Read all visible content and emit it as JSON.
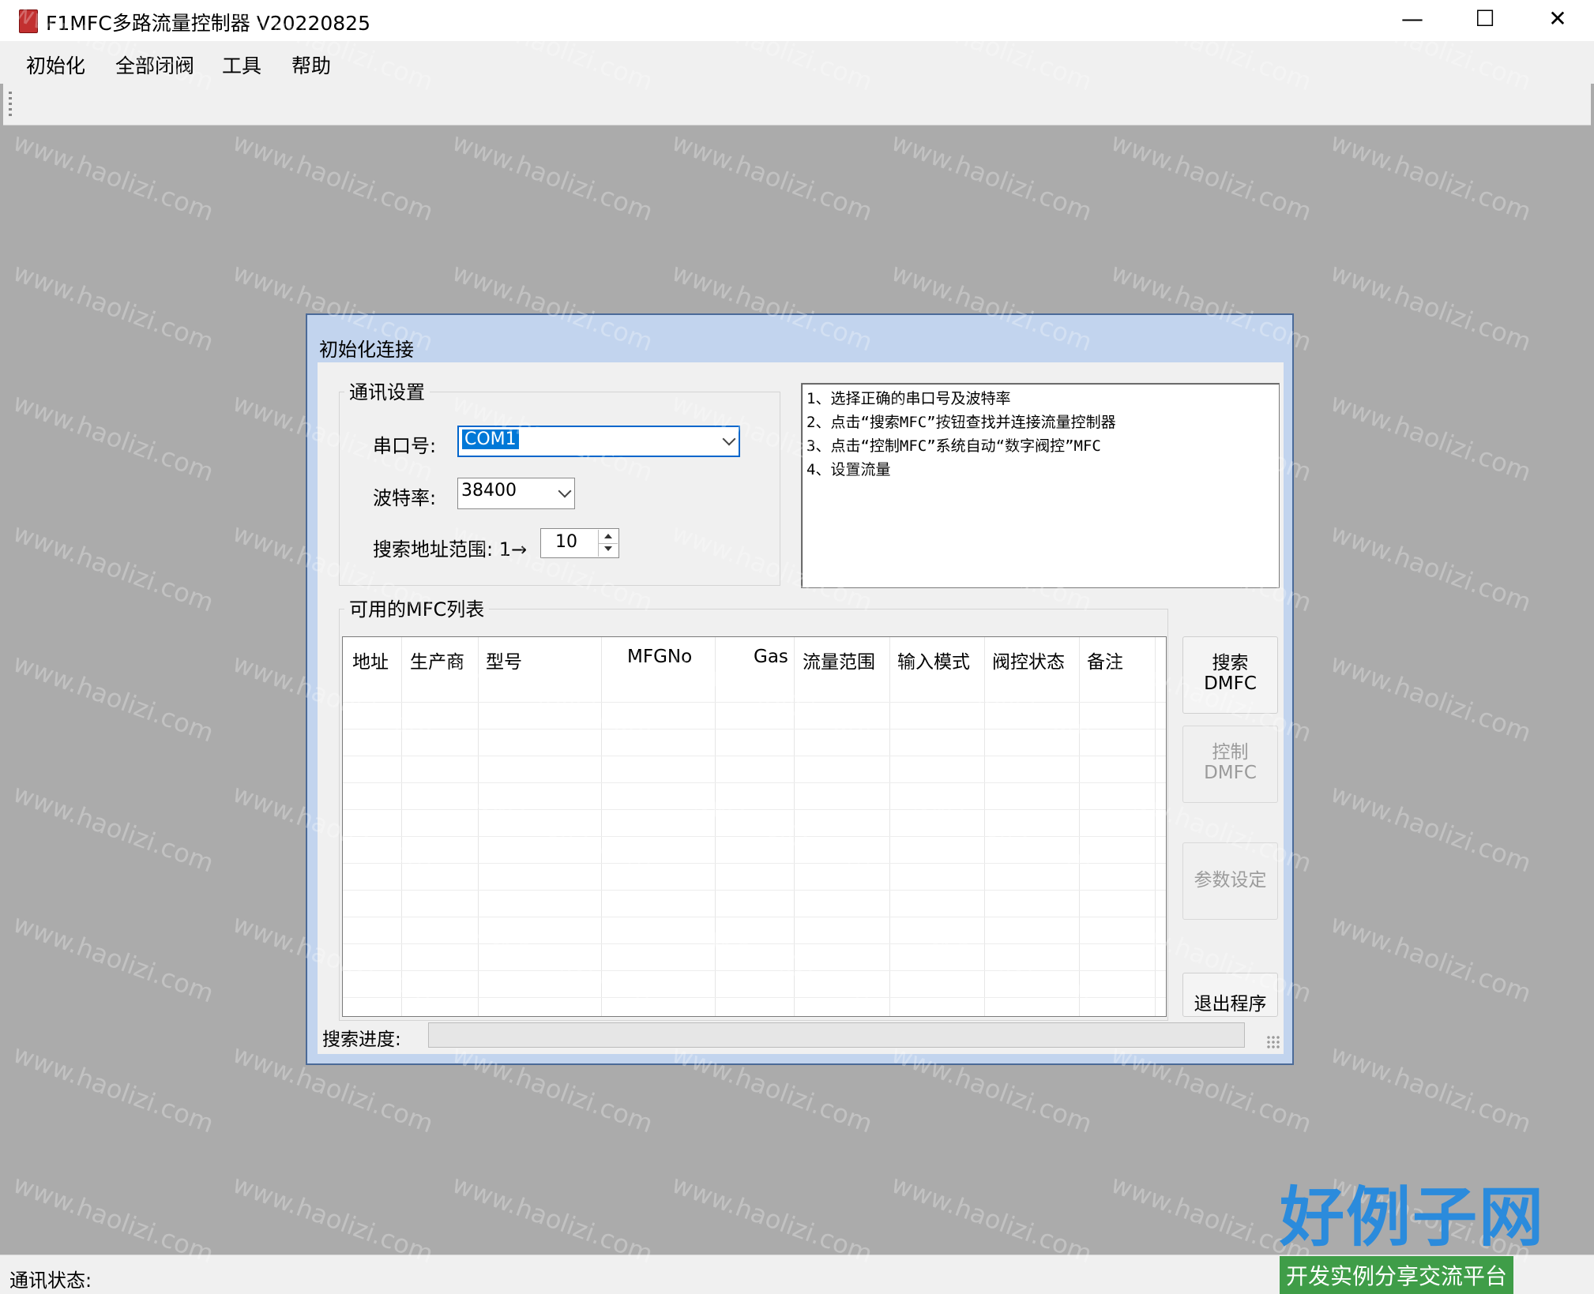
{
  "window": {
    "title": "F1MFC多路流量控制器 V20220825",
    "minimize_glyph": "—",
    "maximize_glyph": "☐",
    "close_glyph": "✕"
  },
  "menu": [
    "初始化",
    "全部闭阀",
    "工具",
    "帮助"
  ],
  "dialog": {
    "title": "初始化连接",
    "comm_group": {
      "label": "通讯设置",
      "port_label": "串口号:",
      "port_value": "COM1",
      "baud_label": "波特率:",
      "baud_value": "38400",
      "range_label": "搜索地址范围: 1→",
      "range_value": "10"
    },
    "instructions": [
      "1、选择正确的串口号及波特率",
      "2、点击“搜索MFC”按钮查找并连接流量控制器",
      "3、点击“控制MFC”系统自动“数字阀控”MFC",
      "4、设置流量"
    ],
    "mfc_list": {
      "label": "可用的MFC列表",
      "columns": [
        "地址",
        "生产商",
        "型号",
        "MFGNo",
        "Gas",
        "流量范围",
        "输入模式",
        "阀控状态",
        "备注"
      ],
      "rows": []
    },
    "buttons": {
      "search": "搜索\nDMFC",
      "control": "控制\nDMFC",
      "params": "参数设定",
      "exit": "退出程序"
    },
    "progress_label": "搜索进度:",
    "progress_value": 0
  },
  "status": {
    "label": "通讯状态:"
  },
  "icons": [
    "app-icon",
    "chevron-down-icon",
    "spin-up-icon",
    "spin-down-icon",
    "resize-grip-icon"
  ],
  "colors": {
    "dialog_border": "#4b6a98",
    "dialog_frame": "#c2d4ee",
    "selection": "#0078d7",
    "mdi_background": "#ababab"
  },
  "watermark": {
    "logo": "好例子网",
    "tagline": "开发实例分享交流平台",
    "repeat_text": "www.haolizi.com"
  }
}
